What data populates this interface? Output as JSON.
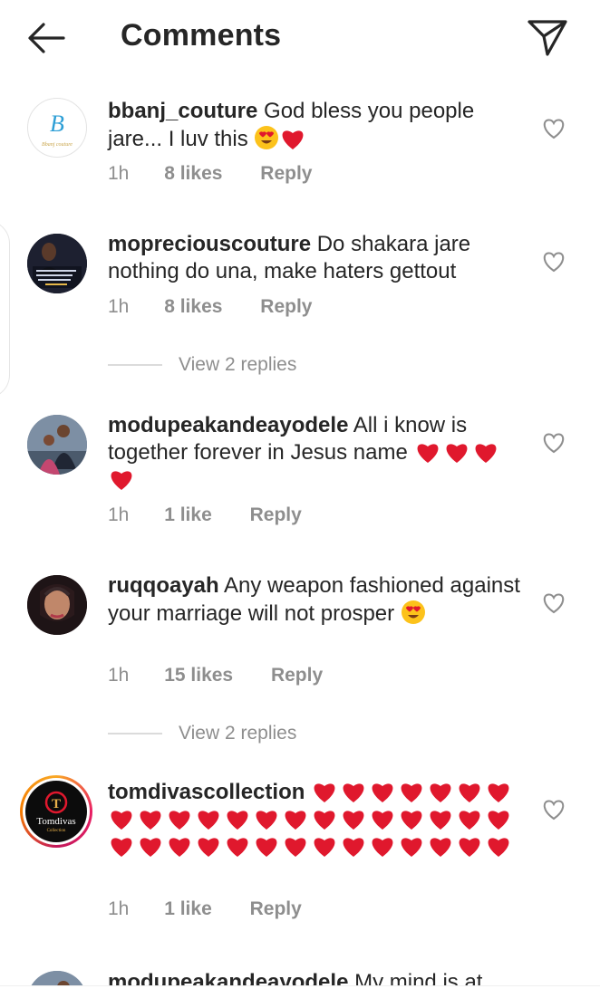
{
  "header": {
    "title": "Comments",
    "back_icon": "arrow-left-icon",
    "send_icon": "paper-plane-icon"
  },
  "colors": {
    "text": "#262626",
    "muted": "#8e8e8e",
    "heart": "#e0182d",
    "divider": "#dbdbdb"
  },
  "comments": [
    {
      "username": "bbanj_couture",
      "text": "God bless you people jare... I luv this",
      "emojis": [
        "heart-eyes",
        "red-heart"
      ],
      "time": "1h",
      "likes": "8 likes",
      "reply": "Reply",
      "avatar_text": "B",
      "avatar_sub": "Bbanj couture"
    },
    {
      "username": "mopreciouscouture",
      "text": "Do shakara jare nothing do una, make haters gettout",
      "time": "1h",
      "likes": "8 likes",
      "reply": "Reply",
      "view_replies": "View 2 replies"
    },
    {
      "username": "modupeakandeayodele",
      "text": "All i know is together forever in Jesus name",
      "hearts": 4,
      "time": "1h",
      "likes": "1 like",
      "reply": "Reply"
    },
    {
      "username": "ruqqoayah",
      "text": "Any  weapon fashioned against your marriage will not prosper",
      "emojis": [
        "heart-eyes"
      ],
      "time": "1h",
      "likes": "15 likes",
      "reply": "Reply",
      "view_replies": "View 2 replies"
    },
    {
      "username": "tomdivascollection",
      "hearts": 35,
      "time": "1h",
      "likes": "1 like",
      "reply": "Reply",
      "avatar_text": "Tomdivas",
      "avatar_sub": "Collection"
    },
    {
      "username": "modupeakandeayodele",
      "text": "My mind is at"
    }
  ]
}
